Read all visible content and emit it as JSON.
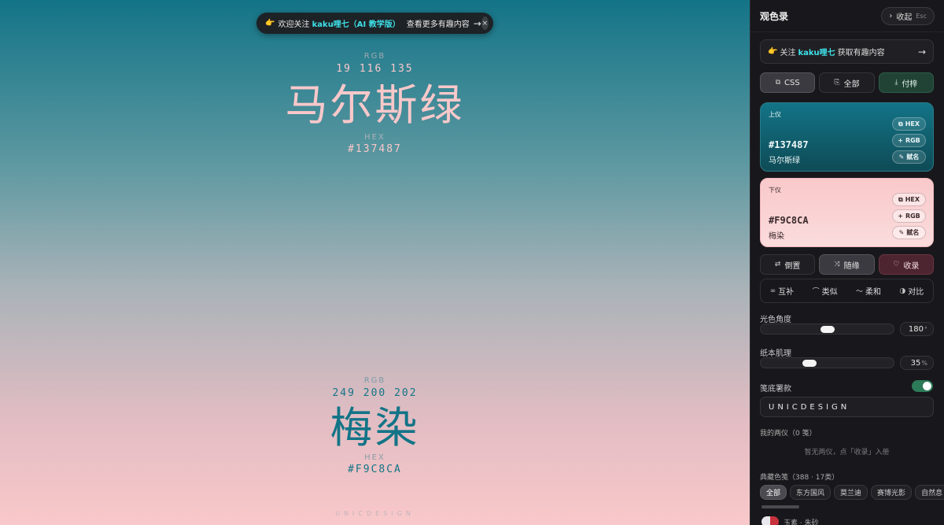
{
  "banner": {
    "prefix": "欢迎关注",
    "highlight": "kaku哩七（AI 教学版）",
    "more": "查看更多有趣内容",
    "arrow": "→",
    "close": "×"
  },
  "top_color": {
    "rgb_label": "RGB",
    "rgb_values": "19 116 135",
    "name": "马尔斯绿",
    "hex_label": "HEX",
    "hex": "#137487",
    "color": "#137487"
  },
  "bottom_color": {
    "rgb_label": "RGB",
    "rgb_values": "249 200 202",
    "name": "梅染",
    "hex_label": "HEX",
    "hex": "#F9C8CA",
    "color": "#F9C8CA"
  },
  "watermark_text": "UNICDESIGN",
  "panel": {
    "title": "观色录",
    "collapse_label": "收起",
    "collapse_key": "Esc",
    "follow": {
      "prefix": "关注",
      "highlight": "kaku哩七",
      "suffix": "获取有趣内容",
      "arrow": "→"
    },
    "actions": {
      "css": "CSS",
      "all": "全部",
      "export": "付梓"
    },
    "top_card": {
      "label": "上仪",
      "hex": "#137487",
      "name": "马尔斯绿",
      "chip_hex": "HEX",
      "chip_rgb": "RGB",
      "chip_rename": "赋名"
    },
    "bottom_card": {
      "label": "下仪",
      "hex": "#F9C8CA",
      "name": "梅染",
      "chip_hex": "HEX",
      "chip_rgb": "RGB",
      "chip_rename": "赋名"
    },
    "controls": {
      "invert": "倒置",
      "random": "随缘",
      "collect": "收录"
    },
    "modes": {
      "complement": "互补",
      "similar": "类似",
      "soft": "柔和",
      "contrast": "对比"
    },
    "angle": {
      "label": "光色角度",
      "value": "180",
      "unit": "°",
      "level": 0.5
    },
    "texture": {
      "label": "纸本肌理",
      "value": "35",
      "unit": "%",
      "level": 0.35
    },
    "watermark": {
      "label": "笺底署款",
      "enabled": true,
      "value": "UNICDESIGN"
    },
    "my_pairs": {
      "title": "我的两仪（0 笺）",
      "empty": "暂无两仪，点「收录」入册"
    },
    "library": {
      "title": "典藏色笺（388 · 17类）",
      "tabs": [
        "全部",
        "东方国风",
        "莫兰迪",
        "赛博光影",
        "自然息"
      ]
    },
    "next_item": {
      "name": "玉素 · 朱砂"
    }
  }
}
